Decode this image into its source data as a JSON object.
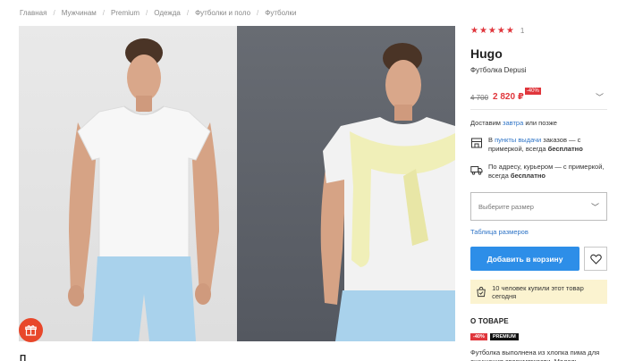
{
  "breadcrumbs": [
    "Главная",
    "Мужчинам",
    "Premium",
    "Одежда",
    "Футболки и поло",
    "Футболки"
  ],
  "gallery": {
    "prev_arrow": "⟵",
    "next_arrow": "⟶",
    "dots_count": 5,
    "active_dot": 1
  },
  "product": {
    "rating_stars": "★★★★★",
    "rating_count": "1",
    "brand": "Hugo",
    "name": "Футболка Depusi",
    "old_price": "4 700",
    "new_price": "2 820 ₽",
    "discount": "-40%"
  },
  "delivery": {
    "prefix": "Доставим ",
    "when": "завтра",
    "suffix": " или позже",
    "pickup_prefix": "В ",
    "pickup_link": "пункты выдачи",
    "pickup_text": " заказов — с примеркой, всегда ",
    "pickup_free": "бесплатно",
    "courier_text": "По адресу, курьером — с примеркой, всегда ",
    "courier_free": "бесплатно"
  },
  "size": {
    "placeholder": "Выберите размер",
    "table_link": "Таблица размеров"
  },
  "actions": {
    "add_to_cart": "Добавить в корзину"
  },
  "bought": "10 человек купили этот товар сегодня",
  "about": {
    "title": "О ТОВАРЕ",
    "tag_sale": "-40%",
    "tag_premium": "PREMIUM",
    "description": "Футболка выполнена из хлопка пима для ощущения сверхмягкости. Модель стандартного кроя. Особенности:"
  },
  "below_gallery_letter": "П",
  "colors": {
    "accent_red": "#e0363c",
    "link_blue": "#2d73c6",
    "button_blue": "#2d8ee8",
    "bought_bg": "#fbf3d0",
    "fab_orange": "#e8472a"
  }
}
